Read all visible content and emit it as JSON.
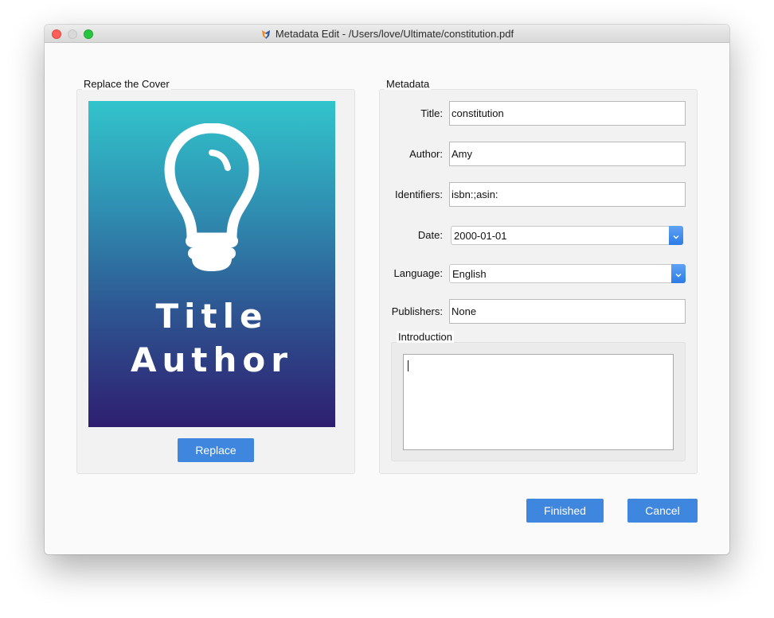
{
  "window": {
    "title": "Metadata Edit - /Users/love/Ultimate/constitution.pdf",
    "app_icon": "app-logo-icon"
  },
  "cover_group": {
    "label": "Replace the Cover",
    "cover_title": "Title",
    "cover_author": "Author",
    "cover_icon": "lightbulb-icon",
    "replace_label": "Replace"
  },
  "metadata_group": {
    "label": "Metadata",
    "fields": {
      "title": {
        "label": "Title:",
        "value": "constitution"
      },
      "author": {
        "label": "Author:",
        "value": "Amy"
      },
      "identifiers": {
        "label": "Identifiers:",
        "value": "isbn:;asin:"
      },
      "date": {
        "label": "Date:",
        "value": "2000-01-01"
      },
      "language": {
        "label": "Language:",
        "value": "English"
      },
      "publishers": {
        "label": "Publishers:",
        "value": "None"
      }
    },
    "introduction": {
      "label": "Introduction",
      "value": ""
    }
  },
  "footer": {
    "finished_label": "Finished",
    "cancel_label": "Cancel"
  },
  "colors": {
    "accent": "#3f86de",
    "cover_top": "#32c4cb",
    "cover_bottom": "#2e1e70"
  }
}
